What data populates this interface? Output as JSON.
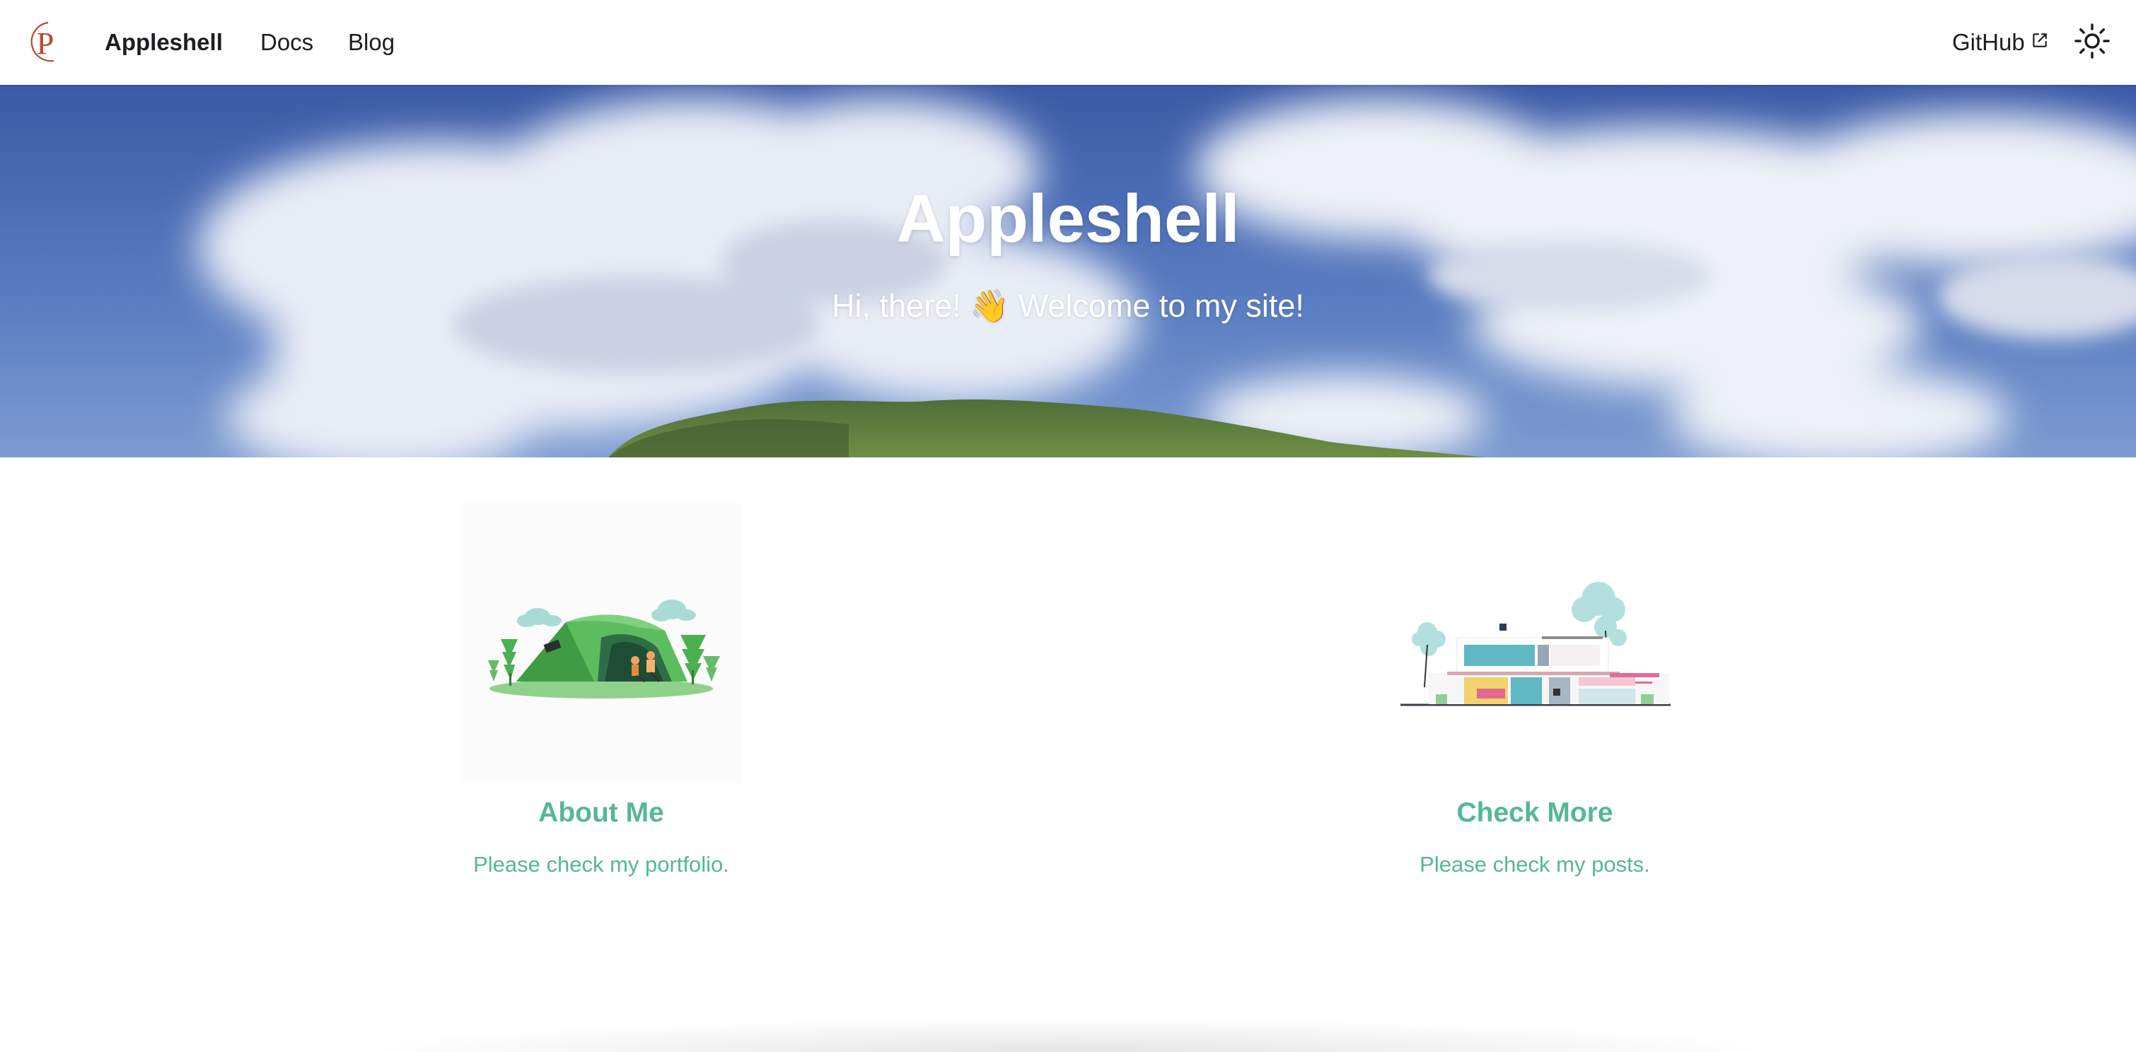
{
  "navbar": {
    "brand_title": "Appleshell",
    "links": [
      {
        "label": "Docs"
      },
      {
        "label": "Blog"
      }
    ],
    "github_label": "GitHub",
    "logo_letter": "P",
    "logo_color": "#c0452d"
  },
  "hero": {
    "title": "Appleshell",
    "subtitle": "Hi, there! 👋 Welcome to my site!",
    "sky_color": "#4a6bb5"
  },
  "features": [
    {
      "title": "About Me",
      "description": "Please check my portfolio.",
      "illustration": "tent-camping-illustration"
    },
    {
      "title": "Check More",
      "description": "Please check my posts.",
      "illustration": "modern-house-illustration"
    }
  ],
  "colors": {
    "accent": "#55b892",
    "text": "#1c1e21"
  }
}
